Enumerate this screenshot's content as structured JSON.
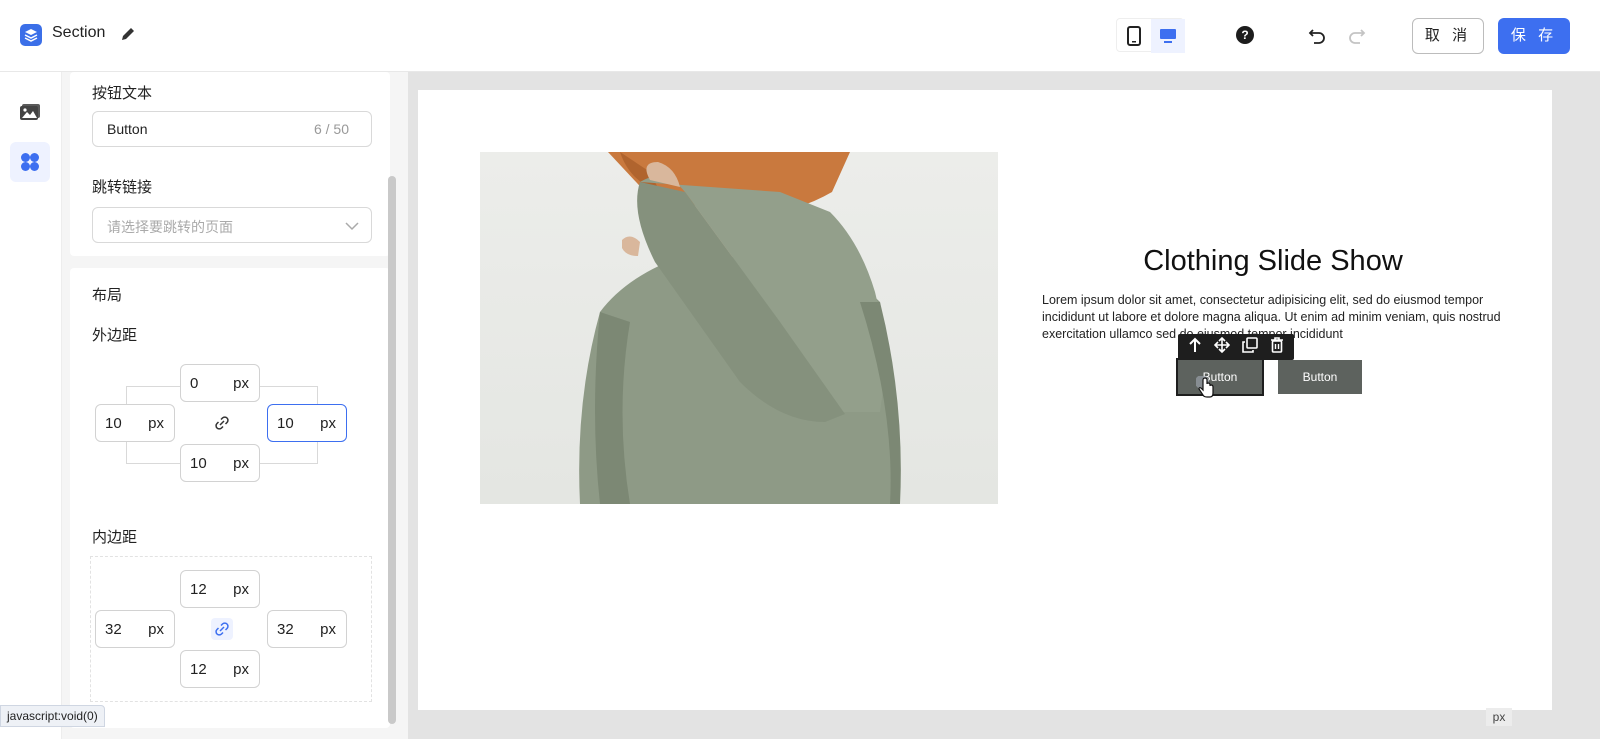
{
  "header": {
    "title": "Section",
    "cancel_label": "取 消",
    "save_label": "保 存",
    "help_symbol": "?"
  },
  "panel": {
    "button_text": {
      "label": "按钮文本",
      "value": "Button",
      "count": "6 / 50"
    },
    "jump_link": {
      "label": "跳转链接",
      "placeholder": "请选择要跳转的页面"
    },
    "layout": {
      "label": "布局",
      "margin": {
        "label": "外边距",
        "top": "0",
        "left": "10",
        "right": "10",
        "bottom": "10",
        "unit": "px"
      },
      "padding": {
        "label": "内边距",
        "top": "12",
        "left": "32",
        "right": "32",
        "bottom": "12",
        "unit": "px"
      }
    }
  },
  "canvas": {
    "title": "Clothing Slide Show",
    "body": "Lorem ipsum dolor sit amet, consectetur adipisicing elit, sed do eiusmod tempor incididunt ut labore et dolore magna aliqua. Ut enim ad minim veniam, quis nostrud exercitation ullamco sed do eiusmod tempor incididunt",
    "button_1": "Button",
    "button_2": "Button"
  },
  "status_bar": {
    "url": "javascript:void(0)",
    "unit_badge": "px"
  },
  "colors": {
    "accent": "#3d6ff0",
    "cta_bg": "#5d625e",
    "sweater": "#8e9a86"
  }
}
